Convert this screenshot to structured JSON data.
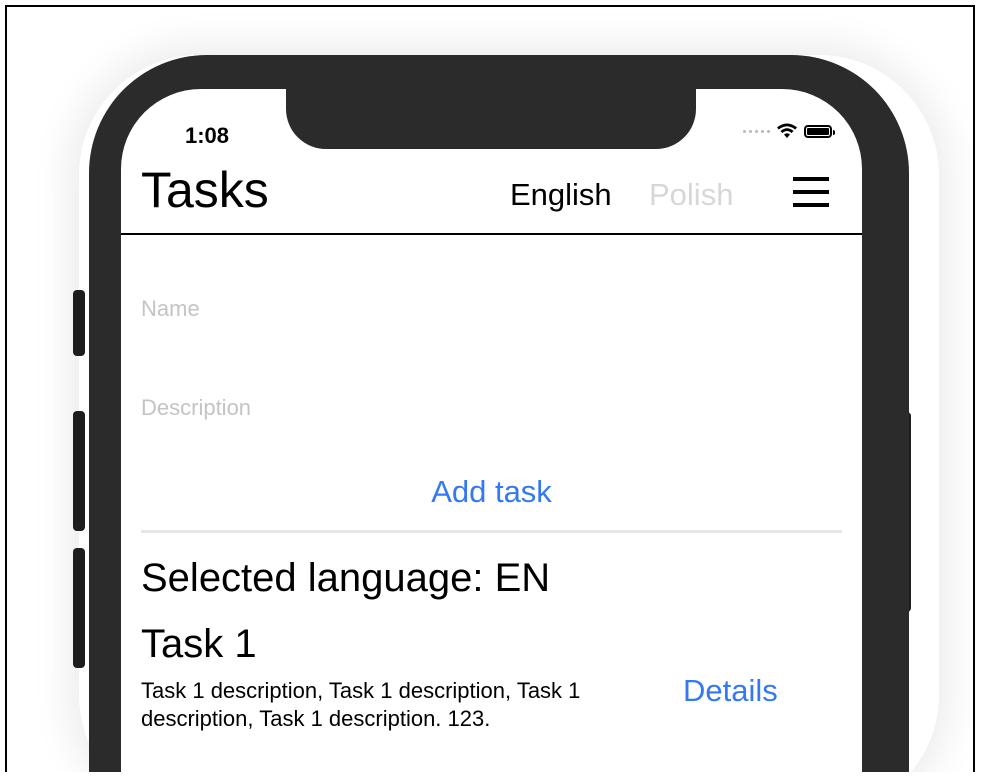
{
  "status_bar": {
    "time": "1:08"
  },
  "header": {
    "title": "Tasks",
    "languages": [
      {
        "label": "English",
        "active": true
      },
      {
        "label": "Polish",
        "active": false
      }
    ],
    "menu_icon": "hamburger-menu-icon"
  },
  "form": {
    "name_placeholder": "Name",
    "description_placeholder": "Description",
    "add_button_label": "Add task"
  },
  "content": {
    "selected_language": "Selected language: EN",
    "tasks": [
      {
        "name": "Task 1",
        "description": "Task 1 description, Task 1 description, Task 1 description, Task 1 description. 123.",
        "details_label": "Details"
      }
    ]
  },
  "colors": {
    "accent": "#3478f6",
    "inactive_text": "#d7d7d7",
    "placeholder": "#c4c4c4",
    "device_frame": "#2b2b2b"
  }
}
